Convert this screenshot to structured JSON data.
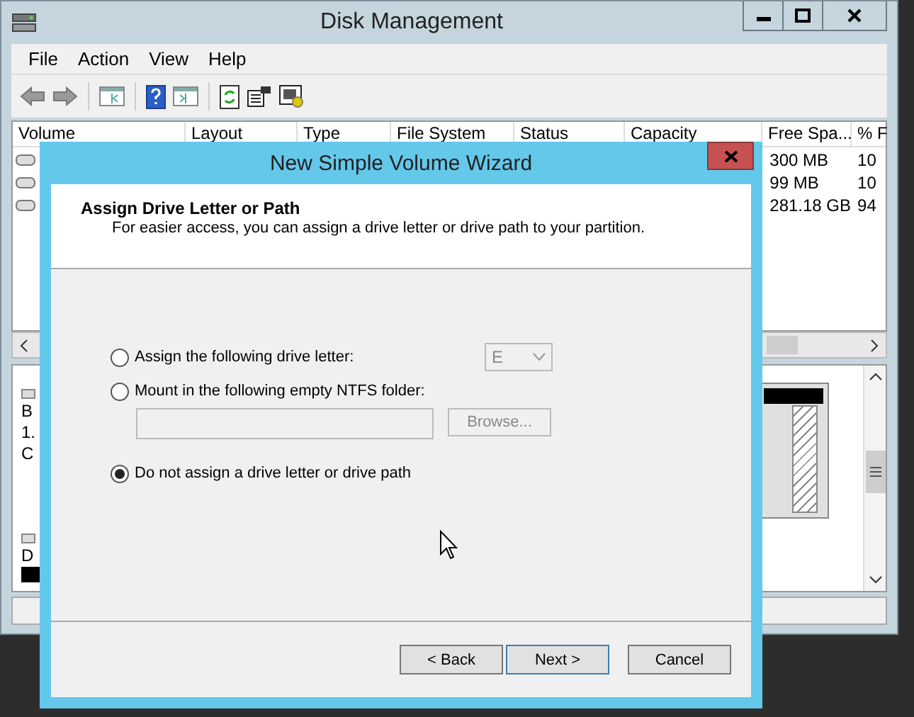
{
  "window": {
    "title": "Disk Management"
  },
  "menu": [
    {
      "label": "File"
    },
    {
      "label": "Action"
    },
    {
      "label": "View"
    },
    {
      "label": "Help"
    }
  ],
  "table": {
    "columns": [
      "Volume",
      "Layout",
      "Type",
      "File System",
      "Status",
      "Capacity",
      "Free Spa...",
      "% F"
    ],
    "rows": [
      {
        "free_space": "300 MB",
        "percent": "10"
      },
      {
        "free_space": "99 MB",
        "percent": "10"
      },
      {
        "free_space": "281.18 GB",
        "percent": "94"
      }
    ]
  },
  "lower_pane": {
    "disk_lines": [
      "B",
      "1.",
      "C"
    ],
    "disk2_line": "D"
  },
  "dialog": {
    "title": "New Simple Volume Wizard",
    "heading": "Assign Drive Letter or Path",
    "subtitle": "For easier access, you can assign a drive letter or drive path to your partition.",
    "options": [
      {
        "kind": "letter",
        "label": "Assign the following drive letter:",
        "selected": false,
        "value": "E"
      },
      {
        "kind": "folder",
        "label": "Mount in the following empty NTFS folder:",
        "selected": false,
        "button": "Browse..."
      },
      {
        "kind": "none",
        "label": "Do not assign a drive letter or drive path",
        "selected": true
      }
    ],
    "buttons": [
      {
        "label": "< Back",
        "default": false
      },
      {
        "label": "Next >",
        "default": true
      },
      {
        "label": "Cancel",
        "default": false
      }
    ]
  }
}
